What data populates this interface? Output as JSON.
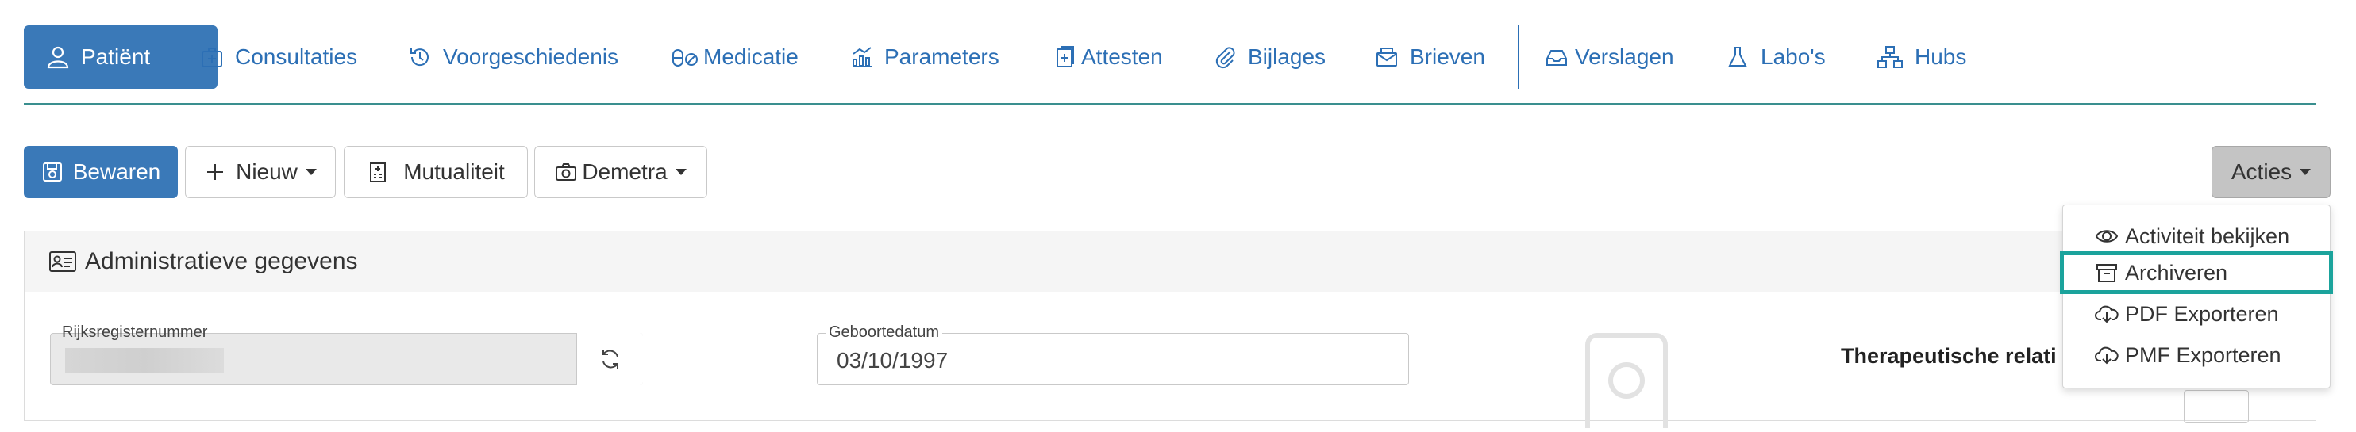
{
  "tabs": [
    {
      "label": "Patiënt",
      "icon": "user-icon",
      "active": true
    },
    {
      "label": "Consultaties",
      "icon": "medical-bag-icon"
    },
    {
      "label": "Voorgeschiedenis",
      "icon": "history-icon"
    },
    {
      "label": "Medicatie",
      "icon": "pills-icon"
    },
    {
      "label": "Parameters",
      "icon": "chart-icon"
    },
    {
      "label": "Attesten",
      "icon": "document-plus-icon"
    },
    {
      "label": "Bijlages",
      "icon": "paperclip-icon"
    },
    {
      "label": "Brieven",
      "icon": "mail-icon"
    },
    {
      "label": "Verslagen",
      "icon": "inbox-icon"
    },
    {
      "label": "Labo's",
      "icon": "flask-icon"
    },
    {
      "label": "Hubs",
      "icon": "network-icon"
    }
  ],
  "toolbar": {
    "save_label": "Bewaren",
    "new_label": "Nieuw",
    "mutualiteit_label": "Mutualiteit",
    "demetra_label": "Demetra",
    "acties_label": "Acties"
  },
  "actions_menu": {
    "items": [
      {
        "label": "Activiteit bekijken",
        "icon": "eye-icon"
      },
      {
        "label": "Archiveren",
        "icon": "archive-icon",
        "highlighted": true
      },
      {
        "label": "PDF Exporteren",
        "icon": "cloud-download-icon"
      },
      {
        "label": "PMF Exporteren",
        "icon": "cloud-download-icon"
      }
    ]
  },
  "card": {
    "title": "Administratieve gegevens",
    "rijksregister_label": "Rijksregisternummer",
    "rijksregister_value": "",
    "geboortedatum_label": "Geboortedatum",
    "geboortedatum_value": "03/10/1997",
    "therapeutic_label": "Therapeutische relati"
  },
  "colors": {
    "primary": "#3a79b8",
    "link": "#2c6fb5",
    "highlight": "#1ba39c",
    "tab_underline": "#3a8f8f"
  }
}
